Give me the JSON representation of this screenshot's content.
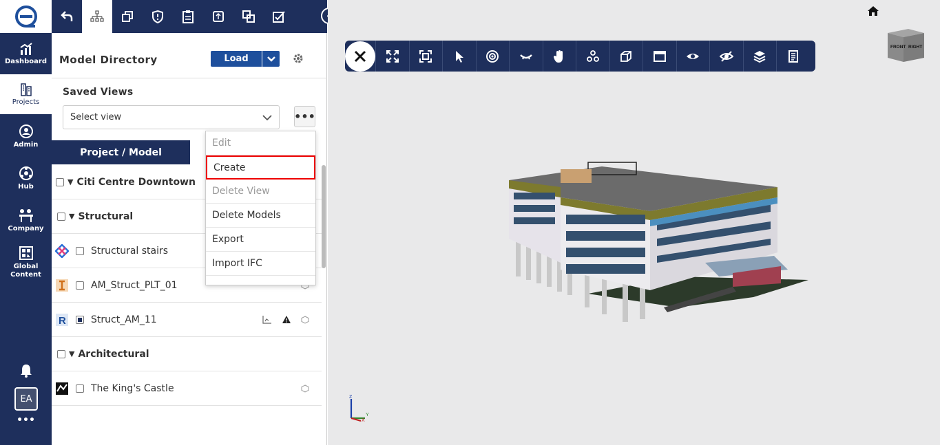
{
  "nav": {
    "logo": "e",
    "items": [
      {
        "label": "Dashboard",
        "icon": "dashboard-icon"
      },
      {
        "label": "Projects",
        "icon": "projects-icon"
      },
      {
        "label": "Admin",
        "icon": "admin-icon"
      },
      {
        "label": "Hub",
        "icon": "hub-icon"
      },
      {
        "label": "Company",
        "icon": "company-icon"
      },
      {
        "label": "Global Content",
        "icon": "global-content-icon"
      }
    ],
    "avatar": "EA",
    "more": "•••"
  },
  "panel": {
    "title": "Model Directory",
    "load_label": "Load",
    "saved_views_label": "Saved Views",
    "select_placeholder": "Select view",
    "more_label": "•••",
    "tab_label": "Project / Model",
    "collapse_label": "«"
  },
  "tree": {
    "root": "Citi Centre Downtown",
    "groups": [
      {
        "label": "Structural"
      },
      {
        "label": "Architectural"
      }
    ],
    "models": [
      {
        "label": "Structural stairs",
        "icon": "tekla-icon"
      },
      {
        "label": "AM_Struct_PLT_01",
        "icon": "ifc-icon"
      },
      {
        "label": "Struct_AM_11",
        "icon": "revit-icon"
      },
      {
        "label": "The King's Castle",
        "icon": "castle-icon"
      }
    ]
  },
  "menu": {
    "items": [
      "Edit",
      "Create",
      "Delete View",
      "Delete Models",
      "Export",
      "Import IFC"
    ]
  },
  "viewer": {
    "cube_front": "FRONT",
    "cube_right": "RIGHT",
    "axis_z": "Z",
    "axis_y": "Y",
    "axis_x": "X"
  },
  "colors": {
    "nav_bg": "#1e2f5c",
    "accent": "#1e4f9c",
    "highlight": "#e00000"
  }
}
